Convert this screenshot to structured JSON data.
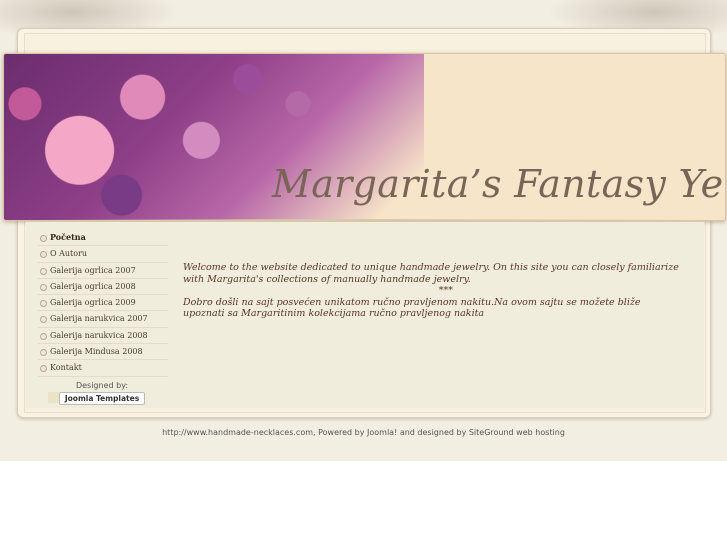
{
  "banner": {
    "title": "Margarita’s Fantasy Yewellry"
  },
  "menu": {
    "items": [
      {
        "label": "Početna",
        "active": true
      },
      {
        "label": "O Autoru"
      },
      {
        "label": "Galerija ogrlica 2007"
      },
      {
        "label": "Galerija ogrlica 2008"
      },
      {
        "label": "Galerija ogrlica 2009"
      },
      {
        "label": "Galerija narukvica 2007"
      },
      {
        "label": "Galerija narukvica 2008"
      },
      {
        "label": "Galerija Mindusa 2008"
      },
      {
        "label": "Kontakt"
      }
    ]
  },
  "designed": {
    "label": "Designed by:",
    "button": "Joomla Templates"
  },
  "main": {
    "intro_en": "Welcome to the website dedicated to unique handmade jewelry. On this site you can closely familiarize with Margarita's collections of manually handmade jewelry.",
    "separator": "***",
    "intro_sr": "Dobro došli na sajt posvećen unikatom ručno pravljenom nakitu.Na ovom sajtu se možete bliže upoznati sa Margaritinim kolekcijama ručno pravljenog nakita"
  },
  "footer": {
    "text": "http://www.handmade-necklaces.com, Powered by Joomla! and designed by SiteGround web hosting"
  }
}
